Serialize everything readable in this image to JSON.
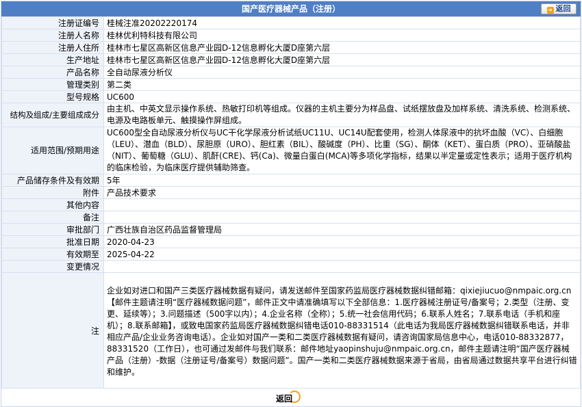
{
  "header": {
    "title": "国产医疗器械产品（注册）",
    "back_label": "返回"
  },
  "rows": [
    {
      "label": "注册证编号",
      "value": "桂械注准20202220174"
    },
    {
      "label": "注册人名称",
      "value": "桂林优利特科技有限公司"
    },
    {
      "label": "注册人住所",
      "value": "桂林市七星区高新区信息产业园D-12信息孵化大厦D座第六层"
    },
    {
      "label": "生产地址",
      "value": "桂林市七星区高新区信息产业园D-12信息孵化大厦D座第六层"
    },
    {
      "label": "产品名称",
      "value": "全自动尿液分析仪"
    },
    {
      "label": "管理类别",
      "value": "第二类"
    },
    {
      "label": "型号规格",
      "value": "UC600"
    },
    {
      "label": "结构及组成/主要组成成分",
      "value": "由主机、中英文显示操作系统、热敏打印机等组成。仪器的主机主要分为样品盘、试纸摆放盘及加样系统、清洗系统、检测系统、电源及电路板单元、触摸操作屏组成。"
    },
    {
      "label": "适用范围/预期用途",
      "value": "UC600型全自动尿液分析仪与UC干化学尿液分析试纸UC11U、UC14U配套使用，检测人体尿液中的抗坏血酸（VC）、白细胞（LEU）、潜血（BLD）、尿胆原（URO）、胆红素（BIL）、酸碱度（PH）、比重（SG）、酮体（KET）、蛋白质（PRO）、亚硝酸盐（NIT）、葡萄糖（GLU）、肌酐(CRE)、钙(Ca)、微量白蛋白(MCA)等多项化学指标，结果以半定量或定性表示；适用于医疗机构的临床检验，为临床医疗提供辅助筛查。"
    },
    {
      "label": "产品储存条件及有效期",
      "value": "5年"
    },
    {
      "label": "附件",
      "value": "产品技术要求"
    },
    {
      "label": "其他内容",
      "value": ""
    },
    {
      "label": "备注",
      "value": ""
    },
    {
      "label": "审批部门",
      "value": "广西壮族自治区药品监督管理局"
    },
    {
      "label": "批准日期",
      "value": "2020-04-23"
    },
    {
      "label": "有效期至",
      "value": "2025-04-22"
    },
    {
      "label": "变更情况",
      "value": ""
    }
  ],
  "note": {
    "label": "注",
    "text": "企业如对进口和国产三类医疗器械数据有疑问，请发送邮件至国家药监局医疗器械数据纠错邮箱：qixiejiucuo@nmpaic.org.cn【邮件主题请注明“医疗器械数据问题”，邮件正文中请准确填写以下全部信息：1.医疗器械注册证号/备案号；2.类型（注册、变更、延续等）；3.问题描述（500字以内）；4.企业名称（全称）；5.统一社会信用代码；6.联系人姓名；7.联系电话（手机和座机）；8.联系邮箱】，或致电国家药监局医疗器械数据纠错电话010-88331514（此电话为我局医疗器械数据纠错联系电话，并非相应产品/企业业务咨询电话）。企业如对国产一类和二类医疗器械数据有疑问，请咨询国家局信息中心，电话010-88332877，88331520（工作日），也可通过发邮件与我们联系：邮件地址yaopinshuju@nmpaic.org.cn，邮件主题请注明“国产医疗器械产品（注册）-数据（注册证号/备案号）数据问题”。国产一类和二类医疗器械数据来源于省局，由省局通过数据共享平台进行纠错和维护。"
  },
  "footer": {
    "back_label": "返回"
  },
  "colors": {
    "title_bar": "#4f7fc5",
    "label_bg": "#eef3fa",
    "border": "#d6e0ee",
    "back_ring": "#f3a11a"
  }
}
